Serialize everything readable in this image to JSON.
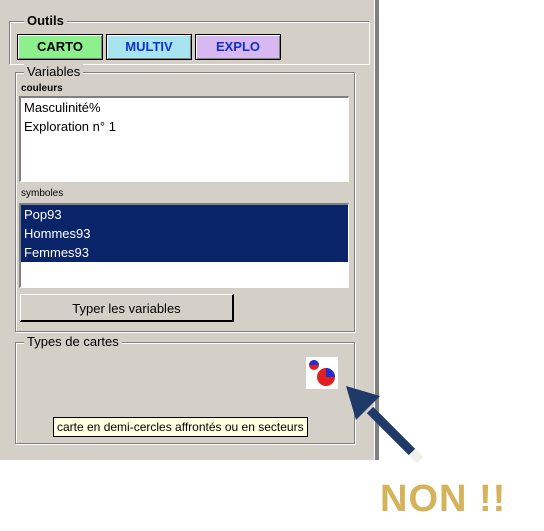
{
  "outils": {
    "title": "Outils",
    "buttons": [
      {
        "label": "CARTO",
        "color": "#8cf08c"
      },
      {
        "label": "MULTIV",
        "color": "#a8e4f0"
      },
      {
        "label": "EXPLO",
        "color": "#d8b8f0"
      }
    ]
  },
  "variables": {
    "title": "Variables",
    "couleurs_label": "couleurs",
    "couleurs_items": [
      "Masculinité%",
      "Exploration n° 1"
    ],
    "symboles_label": "symboles",
    "symboles_items": [
      "Pop93",
      "Hommes93",
      "Femmes93"
    ],
    "typer_button": "Typer les variables"
  },
  "types_cartes": {
    "title": "Types de cartes",
    "icon": "half-circle-pie-chart-icon",
    "tooltip": "carte en demi-cercles affrontés ou en secteurs"
  },
  "annotation": {
    "arrow_color": "#1f3a68",
    "text": "NON !!",
    "text_color": "#d4b35a"
  }
}
